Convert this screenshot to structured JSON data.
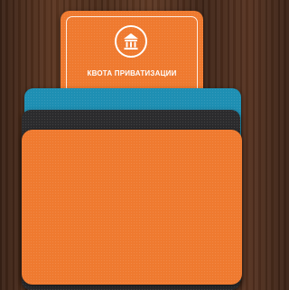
{
  "quota_card": {
    "title": "КВОТА ПРИВАТИЗАЦИИ",
    "icon": "building-icon",
    "color": "#ef7a2f"
  },
  "stack_colors": {
    "blue": "#1e8fb3",
    "black": "#2b2b2d",
    "orange": "#ef7a2f"
  }
}
